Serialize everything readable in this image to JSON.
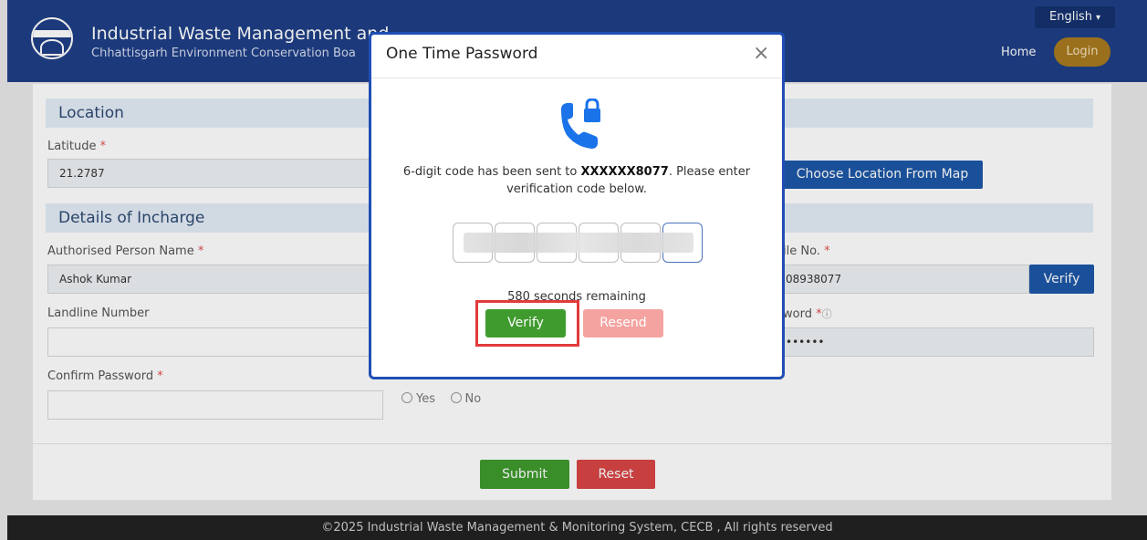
{
  "header": {
    "title": "Industrial Waste Management and",
    "subtitle": "Chhattisgarh Environment Conservation Boa",
    "language": "English",
    "nav_home": "Home",
    "nav_login": "Login"
  },
  "form": {
    "location_section": "Location",
    "latitude_label": "Latitude",
    "latitude_value": "21.2787",
    "choose_location_button": "Choose Location From Map",
    "incharge_section": "Details of Incharge",
    "authorised_person_label": "Authorised Person Name",
    "authorised_person_value": "Ashok Kumar",
    "mobile_label": "ile No.",
    "mobile_value": "08938077",
    "mobile_verify_button": "Verify",
    "landline_label": "Landline Number",
    "landline_value": "",
    "password_label": "word",
    "password_value": "••••••",
    "confirm_password_label": "Confirm Password",
    "confirm_password_value": "",
    "radio_yes": "Yes",
    "radio_no": "No",
    "required_mark": "*",
    "submit_button": "Submit",
    "reset_button": "Reset"
  },
  "footer": {
    "text": "©2025 Industrial Waste Management & Monitoring System, CECB , All rights reserved"
  },
  "modal": {
    "title": "One Time Password",
    "close": "×",
    "message_prefix": "6-digit code has been sent to ",
    "masked_number": "XXXXXX8077",
    "message_suffix": ". Please enter verification code below.",
    "otp_digits": [
      "",
      "",
      "",
      "",
      "",
      ""
    ],
    "remaining": "580 seconds remaining",
    "verify_button": "Verify",
    "resend_button": "Resend"
  },
  "colors": {
    "header_bg": "#1f3f86",
    "accent_blue": "#1f4fb4",
    "verify_green": "#3f9b2e",
    "resend_pink": "#f5a3a0",
    "reset_red": "#d84545",
    "highlight_red": "#e23b3b"
  },
  "icons": {
    "logo": "board-logo-icon",
    "chevron": "chevron-down-icon",
    "close": "close-icon",
    "phone_lock": "phone-lock-icon",
    "info": "info-icon"
  }
}
